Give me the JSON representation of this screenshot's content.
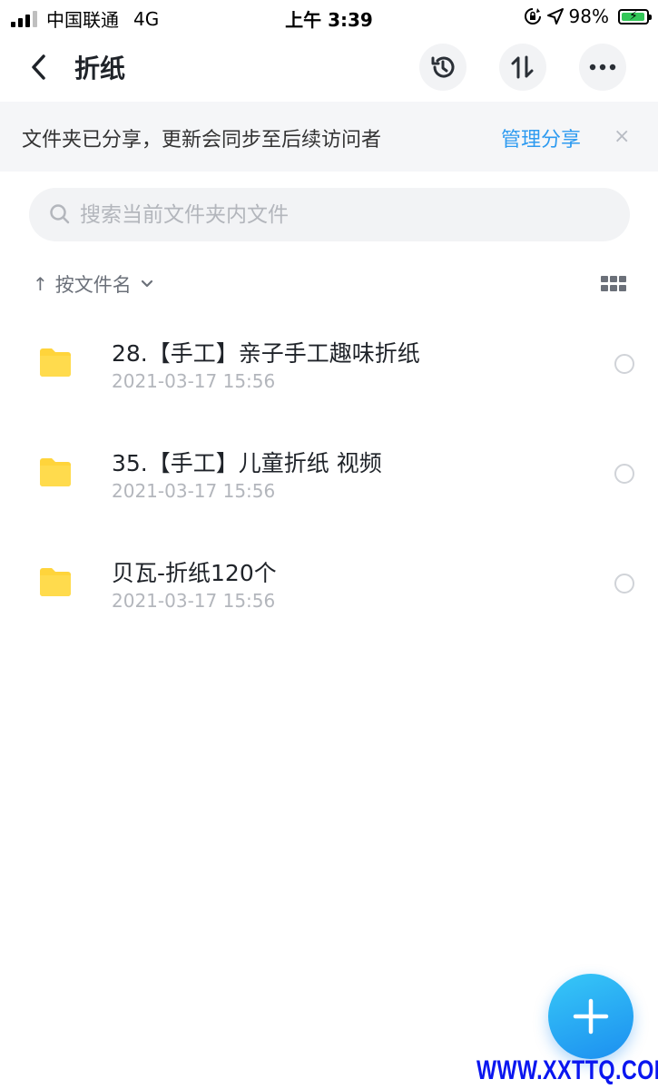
{
  "status_bar": {
    "carrier": "中国联通",
    "network": "4G",
    "time": "上午 3:39",
    "battery_percent": "98%",
    "battery_level": 0.98,
    "icons": [
      "signal-icon",
      "orientation-lock-icon",
      "location-icon",
      "battery-icon"
    ]
  },
  "nav": {
    "title": "折纸",
    "buttons": [
      "back-icon",
      "history-icon",
      "sort-toggle-icon",
      "more-icon"
    ]
  },
  "banner": {
    "text": "文件夹已分享，更新会同步至后续访问者",
    "link": "管理分享",
    "close": "×"
  },
  "search": {
    "placeholder": "搜索当前文件夹内文件",
    "value": ""
  },
  "sort": {
    "arrow": "↑",
    "label": "按文件名",
    "chevron": "⌄"
  },
  "files": [
    {
      "name": "28.【手工】亲子手工趣味折纸",
      "date": "2021-03-17 15:56",
      "type": "folder"
    },
    {
      "name": "35.【手工】儿童折纸 视频",
      "date": "2021-03-17 15:56",
      "type": "folder"
    },
    {
      "name": "贝瓦-折纸120个",
      "date": "2021-03-17 15:56",
      "type": "folder"
    }
  ],
  "fab": {
    "icon": "plus-icon"
  },
  "watermark": "WWW.XXTTQ.COM",
  "colors": {
    "accent": "#2e9bf0",
    "folder": "#ffd43b",
    "fab_start": "#37c8f7",
    "fab_end": "#1c8ff0",
    "watermark": "#0a16f0"
  }
}
